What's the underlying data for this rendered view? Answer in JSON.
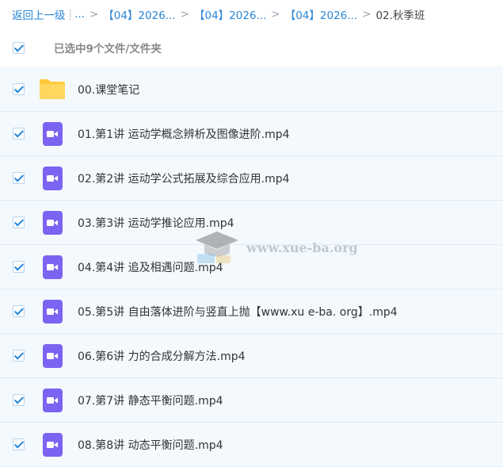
{
  "breadcrumb": {
    "back": "返回上一级",
    "ellipsis": "...",
    "crumbs": [
      "【04】2026...",
      "【04】2026...",
      "【04】2026..."
    ],
    "current": "02.秋季班"
  },
  "selection": {
    "label": "已选中9个文件/文件夹"
  },
  "files": [
    {
      "name": "00.课堂笔记",
      "icon": "folder-icon"
    },
    {
      "name": "01.第1讲 运动学概念辨析及图像进阶.mp4",
      "icon": "video-icon"
    },
    {
      "name": "02.第2讲 运动学公式拓展及综合应用.mp4",
      "icon": "video-icon"
    },
    {
      "name": "03.第3讲 运动学推论应用.mp4",
      "icon": "video-icon"
    },
    {
      "name": "04.第4讲 追及相遇问题.mp4",
      "icon": "video-icon"
    },
    {
      "name": "05.第5讲 自由落体进阶与竖直上抛【www.xu e-ba. org】.mp4",
      "icon": "video-icon"
    },
    {
      "name": "06.第6讲 力的合成分解方法.mp4",
      "icon": "video-icon"
    },
    {
      "name": "07.第7讲 静态平衡问题.mp4",
      "icon": "video-icon"
    },
    {
      "name": "08.第8讲 动态平衡问题.mp4",
      "icon": "video-icon"
    }
  ],
  "watermark": {
    "text": "www.xue-ba.org",
    "icon": "graduation-cap-icon"
  },
  "colors": {
    "link": "#2a86d6",
    "checkbox": "#1f86dd",
    "row_bg": "#f4f9fe",
    "video_icon": "#7b64f2",
    "folder_icon": "#ffcb3d"
  }
}
